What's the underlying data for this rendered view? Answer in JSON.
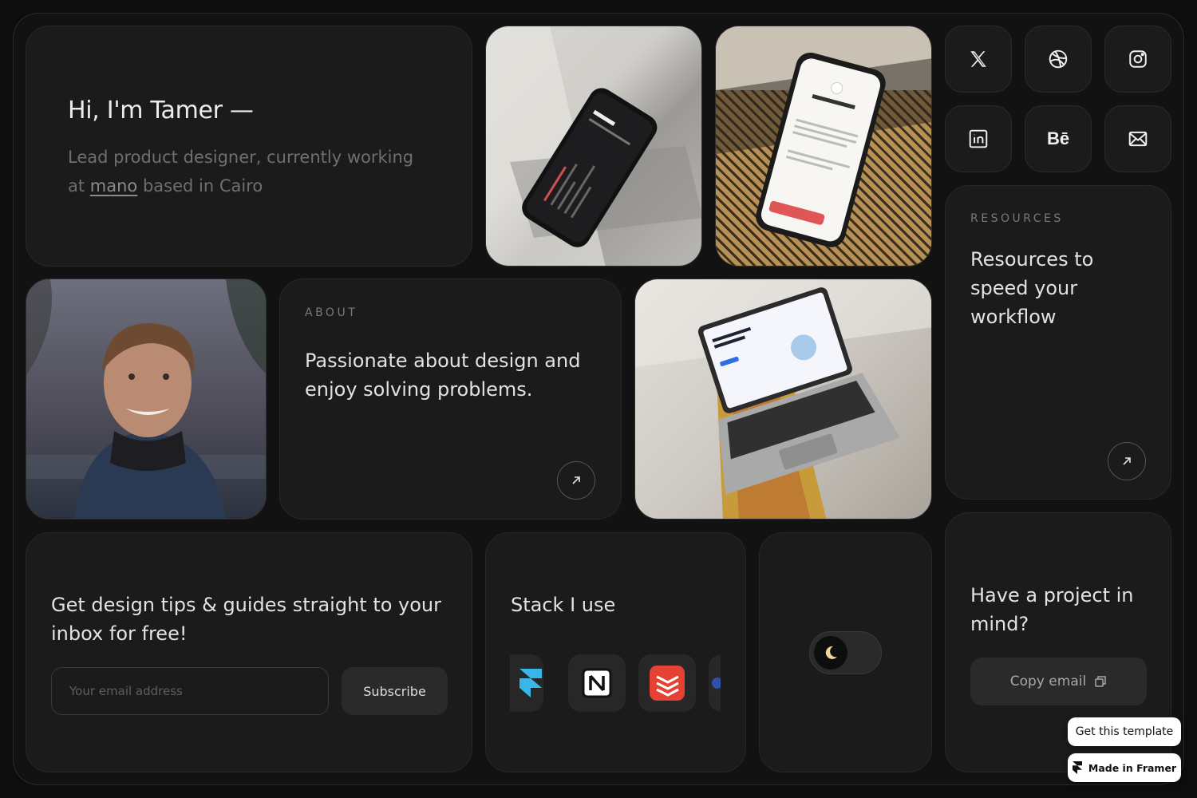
{
  "hero": {
    "title": "Hi, I'm Tamer —",
    "subtitle_before": "Lead product designer, currently working at ",
    "company_link": "mano",
    "subtitle_after": " based in Cairo"
  },
  "social": [
    {
      "name": "x-icon"
    },
    {
      "name": "dribbble-icon"
    },
    {
      "name": "instagram-icon"
    },
    {
      "name": "linkedin-icon"
    },
    {
      "name": "behance-icon"
    },
    {
      "name": "mail-icon"
    }
  ],
  "about": {
    "eyebrow": "ABOUT",
    "text": "Passionate about design and enjoy solving problems."
  },
  "resources": {
    "eyebrow": "RESOURCES",
    "text": "Resources to speed your workflow"
  },
  "newsletter": {
    "heading": "Get design tips & guides straight to your inbox for free!",
    "placeholder": "Your email address",
    "button": "Subscribe"
  },
  "stack": {
    "heading": "Stack I use",
    "apps": [
      "framer-icon",
      "notion-icon",
      "todoist-icon",
      "partial-app-icon"
    ]
  },
  "theme": {
    "mode": "dark",
    "icon": "moon-icon"
  },
  "contact": {
    "heading": "Have a project in mind?",
    "button": "Copy email"
  },
  "badges": {
    "template": "Get this template",
    "framer": "Made in Framer"
  },
  "colors": {
    "background": "#121212",
    "card": "#1b1b1b",
    "todoist_red": "#e44232",
    "moon": "#f2d49b"
  }
}
